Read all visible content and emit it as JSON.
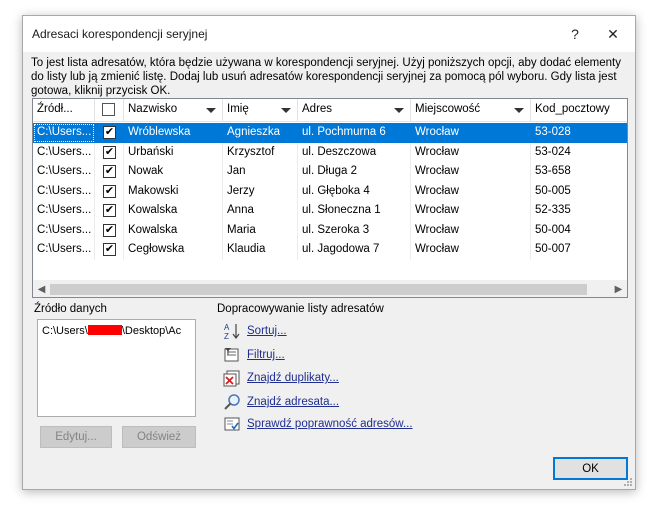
{
  "dialog": {
    "title": "Adresaci korespondencji seryjnej",
    "help_glyph": "?",
    "close_glyph": "✕",
    "description": "To jest lista adresatów, która będzie używana w korespondencji seryjnej. Użyj poniższych opcji, aby dodać elementy do listy lub ją zmienić listę. Dodaj lub usuń adresatów korespondencji seryjnej za pomocą pól wyboru. Gdy lista jest gotowa, kliknij przycisk OK."
  },
  "table": {
    "columns": [
      {
        "key": "source",
        "label": "Źródł..."
      },
      {
        "key": "check",
        "label": ""
      },
      {
        "key": "nazwisko",
        "label": "Nazwisko"
      },
      {
        "key": "imie",
        "label": "Imię"
      },
      {
        "key": "adres",
        "label": "Adres"
      },
      {
        "key": "miejscowosc",
        "label": "Miejscowość"
      },
      {
        "key": "kod",
        "label": "Kod_pocztowy"
      }
    ],
    "rows": [
      {
        "source": "C:\\Users...",
        "checked": "✔",
        "nazwisko": "Wróblewska",
        "imie": "Agnieszka",
        "adres": "ul. Pochmurna 6",
        "miejscowosc": "Wrocław",
        "kod": "53-028"
      },
      {
        "source": "C:\\Users...",
        "checked": "✔",
        "nazwisko": "Urbański",
        "imie": "Krzysztof",
        "adres": "ul. Deszczowa",
        "miejscowosc": "Wrocław",
        "kod": "53-024"
      },
      {
        "source": "C:\\Users...",
        "checked": "✔",
        "nazwisko": "Nowak",
        "imie": "Jan",
        "adres": "ul. Długa 2",
        "miejscowosc": "Wrocław",
        "kod": "53-658"
      },
      {
        "source": "C:\\Users...",
        "checked": "✔",
        "nazwisko": "Makowski",
        "imie": "Jerzy",
        "adres": "ul. Głęboka 4",
        "miejscowosc": "Wrocław",
        "kod": "50-005"
      },
      {
        "source": "C:\\Users...",
        "checked": "✔",
        "nazwisko": "Kowalska",
        "imie": "Anna",
        "adres": "ul. Słoneczna 1",
        "miejscowosc": "Wrocław",
        "kod": "52-335"
      },
      {
        "source": "C:\\Users...",
        "checked": "✔",
        "nazwisko": "Kowalska",
        "imie": "Maria",
        "adres": "ul. Szeroka 3",
        "miejscowosc": "Wrocław",
        "kod": "50-004"
      },
      {
        "source": "C:\\Users...",
        "checked": "✔",
        "nazwisko": "Cegłowska",
        "imie": "Klaudia",
        "adres": "ul. Jagodowa 7",
        "miejscowosc": "Wrocław",
        "kod": "50-007"
      }
    ],
    "scroll_left": "◀",
    "scroll_right": "▶"
  },
  "datasource": {
    "label": "Źródło danych",
    "item_prefix": "C:\\Users\\",
    "item_suffix": "\\Desktop\\Ac",
    "edit_button": "Edytuj...",
    "refresh_button": "Odśwież"
  },
  "refine": {
    "label": "Dopracowywanie listy adresatów",
    "items": [
      {
        "label": "Sortuj...",
        "icon": "sort-az-icon"
      },
      {
        "label": "Filtruj...",
        "icon": "filter-icon"
      },
      {
        "label": "Znajdź duplikaty...",
        "icon": "find-duplicates-icon"
      },
      {
        "label": "Znajdź adresata...",
        "icon": "find-recipient-icon"
      },
      {
        "label": "Sprawdź poprawność adresów...",
        "icon": "validate-addresses-icon"
      }
    ]
  },
  "buttons": {
    "ok": "OK"
  },
  "colors": {
    "selection": "#0078d7",
    "link": "#1f2e8f",
    "redaction": "#ff0000"
  }
}
